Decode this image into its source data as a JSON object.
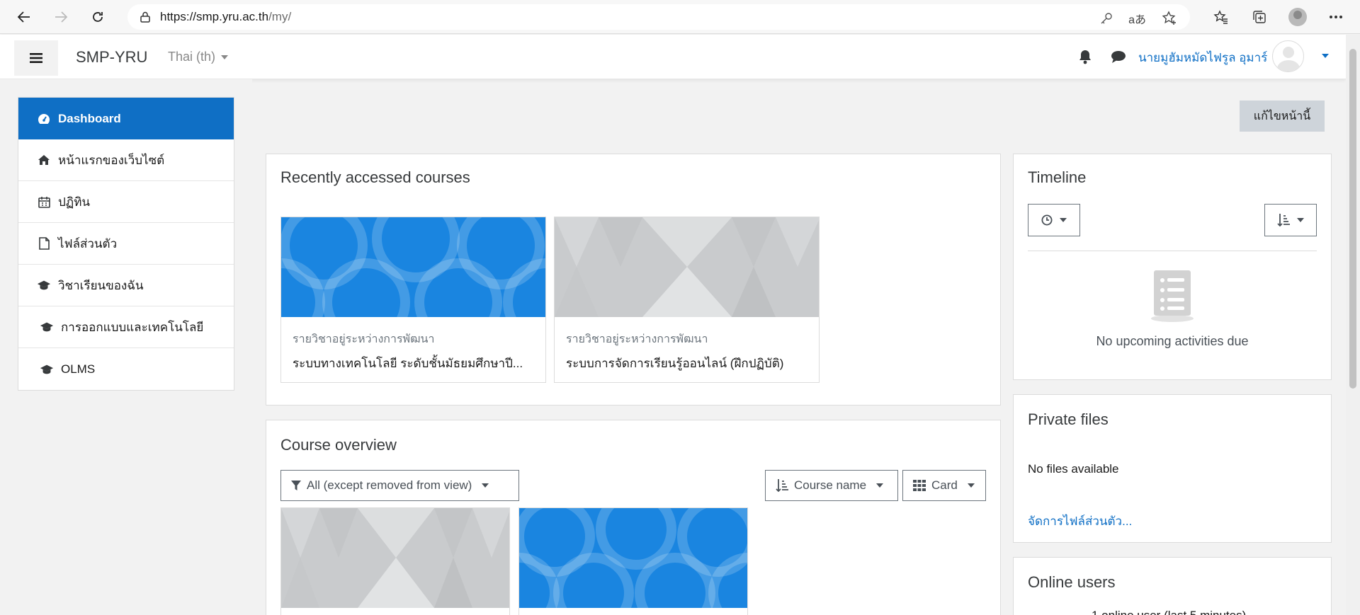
{
  "browser": {
    "url_host": "https://smp.yru.ac.th",
    "url_path": "/my/"
  },
  "navbar": {
    "brand": "SMP-YRU",
    "language": "Thai (th)",
    "username": "นายมูฮัมหมัดไฟรูล อุมาร์"
  },
  "sidebar": {
    "items": [
      {
        "label": "Dashboard",
        "icon": "dashboard-icon",
        "active": true
      },
      {
        "label": "หน้าแรกของเว็บไซต์",
        "icon": "home-icon"
      },
      {
        "label": "ปฏิทิน",
        "icon": "calendar-icon"
      },
      {
        "label": "ไฟล์ส่วนตัว",
        "icon": "file-icon"
      },
      {
        "label": "วิชาเรียนของฉัน",
        "icon": "graduation-cap-icon"
      },
      {
        "label": "การออกแบบและเทคโนโลยี",
        "icon": "graduation-cap-icon"
      },
      {
        "label": "OLMS",
        "icon": "graduation-cap-icon"
      }
    ]
  },
  "main": {
    "edit_button": "แก้ไขหน้านี้",
    "recent": {
      "title": "Recently accessed courses",
      "courses": [
        {
          "category": "รายวิชาอยู่ระหว่างการพัฒนา",
          "name": "ระบบทางเทคโนโลยี ระดับชั้นมัธยมศึกษาปี...",
          "image": "blue"
        },
        {
          "category": "รายวิชาอยู่ระหว่างการพัฒนา",
          "name": "ระบบการจัดการเรียนรู้ออนไลน์ (ฝึกปฏิบัติ)",
          "image": "grey"
        }
      ]
    },
    "overview": {
      "title": "Course overview",
      "filter": "All (except removed from view)",
      "sort": "Course name",
      "view": "Card"
    }
  },
  "blocks": {
    "timeline": {
      "title": "Timeline",
      "empty": "No upcoming activities due"
    },
    "private_files": {
      "title": "Private files",
      "empty": "No files available",
      "manage_link": "จัดการไฟล์ส่วนตัว..."
    },
    "online_users": {
      "title": "Online users",
      "text": "1 online user (last 5 minutes)"
    }
  },
  "colors": {
    "primary": "#0f6fc5",
    "course_blue": "#1a85e0",
    "course_grey": "#c9cbcd"
  }
}
